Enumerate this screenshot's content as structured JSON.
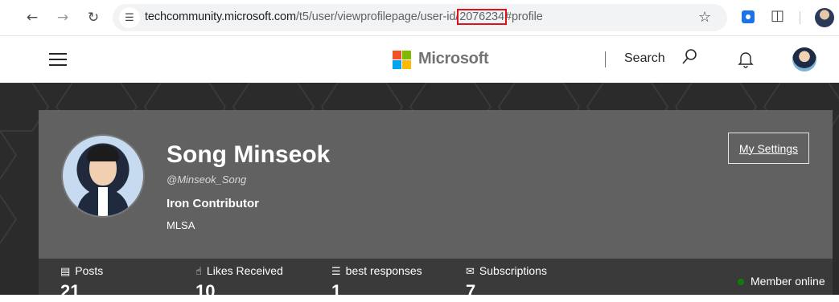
{
  "browser": {
    "url_host": "techcommunity.microsoft.com",
    "url_path_before": "/t5/user/viewprofilepage/user-id/",
    "url_highlight": "2076234",
    "url_after": "#profile"
  },
  "header": {
    "brand": "Microsoft",
    "search_label": "Search"
  },
  "profile": {
    "name": "Song Minseok",
    "handle": "@Minseok_Song",
    "rank": "Iron Contributor",
    "organization": "MLSA",
    "settings_label": "My Settings"
  },
  "stats": [
    {
      "label": "Posts",
      "value": "21",
      "icon": "message-icon"
    },
    {
      "label": "Likes Received",
      "value": "10",
      "icon": "thumbs-up-icon"
    },
    {
      "label": "best responses",
      "value": "1",
      "icon": "checklist-icon"
    },
    {
      "label": "Subscriptions",
      "value": "7",
      "icon": "envelope-icon"
    }
  ],
  "status": {
    "online_label": "Member online",
    "online_color": "#107c10"
  },
  "colors": {
    "highlight_box": "#e0111a",
    "card_bg": "#616161",
    "banner_bg": "#2b2b2b"
  }
}
